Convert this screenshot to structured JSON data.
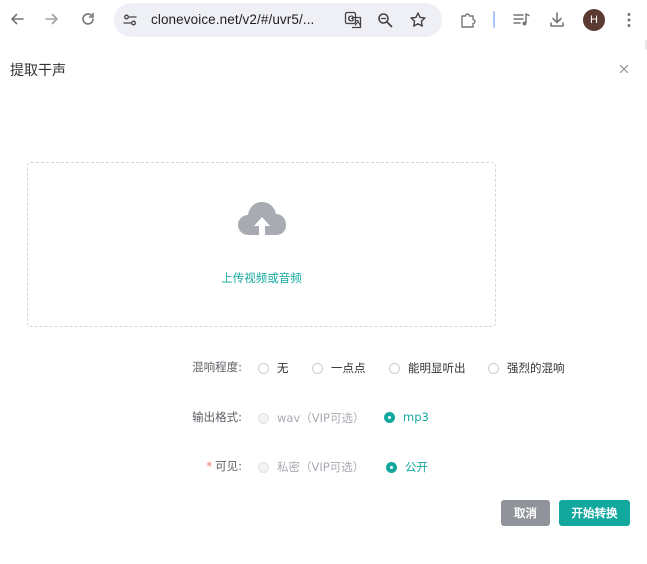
{
  "browser": {
    "url": "clonevoice.net/v2/#/uvr5/...",
    "avatar_letter": "H"
  },
  "dialog": {
    "title": "提取干声",
    "upload_text": "上传视频或音频"
  },
  "form": {
    "reverb": {
      "label": "混响程度:",
      "options": [
        "无",
        "一点点",
        "能明显听出",
        "强烈的混响"
      ]
    },
    "format": {
      "label": "输出格式:",
      "options": [
        "wav（VIP可选）",
        "mp3"
      ],
      "selected": "mp3"
    },
    "visibility": {
      "required_mark": "*",
      "label": "可见:",
      "options": [
        "私密（VIP可选）",
        "公开"
      ],
      "selected": "公开"
    }
  },
  "buttons": {
    "cancel": "取消",
    "start": "开始转换"
  },
  "colors": {
    "accent": "#13a89e",
    "cancel_bg": "#909399",
    "avatar_bg": "#5b3b31"
  }
}
